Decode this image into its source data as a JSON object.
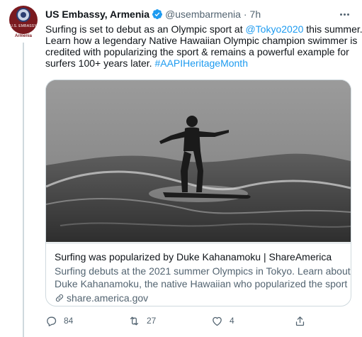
{
  "account": {
    "display_name": "US Embassy, Armenia",
    "handle": "@usembarmenia",
    "separator": "·",
    "time": "7h",
    "avatar_text": "U.S. EMBASSY",
    "avatar_label": "Armenia",
    "verified": true
  },
  "tweet": {
    "line1_before": "Surfing is set to debut as an Olympic sport at ",
    "line1_mention": "@Tokyo2020",
    "line1_after": " this summer.",
    "line2": "Learn how a legendary Native Hawaiian Olympic champion swimmer is",
    "line3": "credited with popularizing the sport & remains a powerful example for",
    "line4_before": "surfers 100+ years later. ",
    "line4_hashtag": "#AAPIHeritageMonth"
  },
  "card": {
    "image_alt": "Black-and-white photo of a surfer standing on a board riding a wave",
    "title": "Surfing was popularized by Duke Kahanamoku | ShareAmerica",
    "description_line1": "Surfing debuts at the 2021 summer Olympics in Tokyo. Learn about",
    "description_line2": "Duke Kahanamoku, the native Hawaiian who popularized the sport ...",
    "domain": "share.america.gov"
  },
  "actions": {
    "reply_count": "84",
    "retweet_count": "27",
    "like_count": "4",
    "share_label": ""
  },
  "colors": {
    "accent": "#1d9bf0",
    "text": "#0f1419",
    "secondary": "#536471",
    "border": "#cfd9de"
  },
  "icons": [
    "verified-icon",
    "more-icon",
    "link-icon",
    "reply-icon",
    "retweet-icon",
    "like-icon",
    "share-icon"
  ]
}
